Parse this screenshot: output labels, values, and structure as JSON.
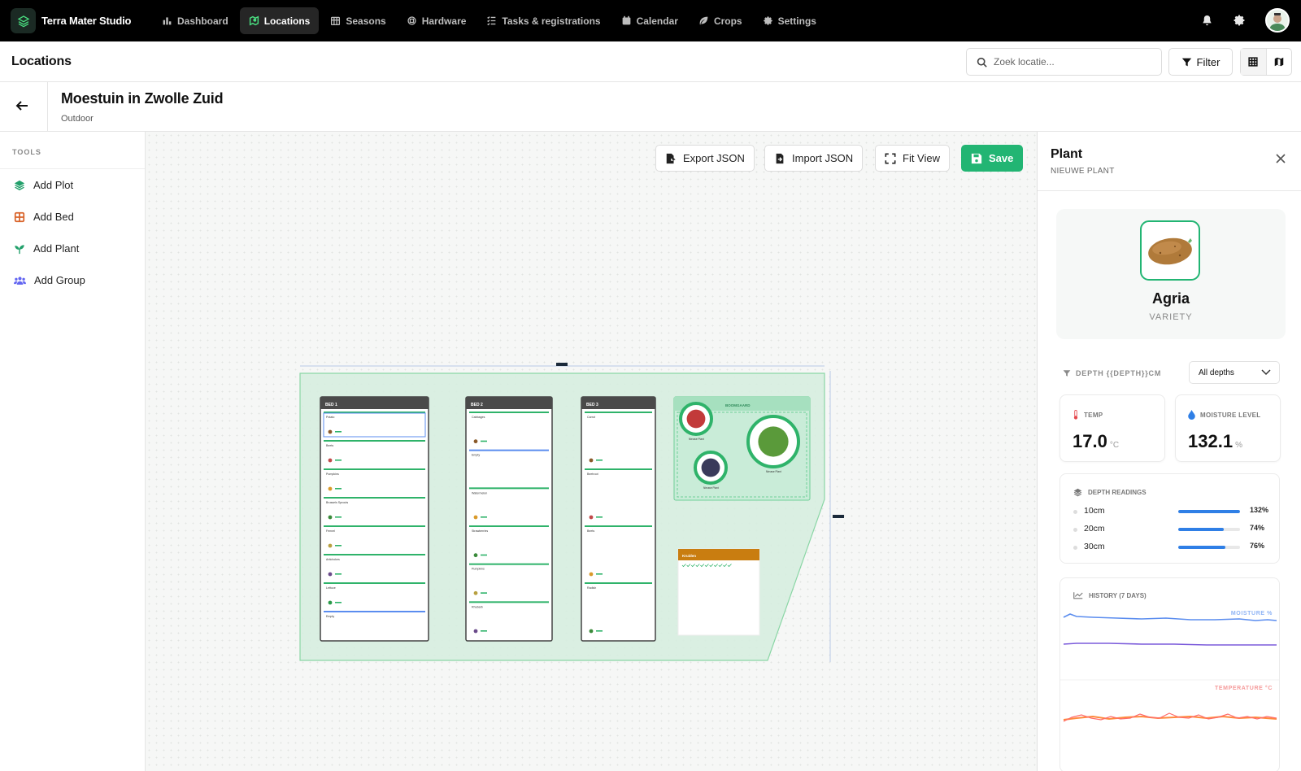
{
  "brand": {
    "name": "Terra Mater Studio"
  },
  "nav": [
    {
      "label": "Dashboard",
      "icon": "bar-chart-icon",
      "active": false
    },
    {
      "label": "Locations",
      "icon": "map-marker-icon",
      "active": true
    },
    {
      "label": "Seasons",
      "icon": "calendar-grid-icon",
      "active": false
    },
    {
      "label": "Hardware",
      "icon": "chip-icon",
      "active": false
    },
    {
      "label": "Tasks & registrations",
      "icon": "checklist-icon",
      "active": false
    },
    {
      "label": "Calendar",
      "icon": "calendar-icon",
      "active": false
    },
    {
      "label": "Crops",
      "icon": "leaf-icon",
      "active": false
    },
    {
      "label": "Settings",
      "icon": "gear-icon",
      "active": false
    }
  ],
  "header": {
    "title": "Locations",
    "search_placeholder": "Zoek locatie...",
    "filter_label": "Filter"
  },
  "location": {
    "title": "Moestuin in Zwolle Zuid",
    "subtitle": "Outdoor"
  },
  "tools": {
    "label": "TOOLS",
    "items": [
      {
        "label": "Add Plot",
        "icon": "layers-icon",
        "color": "#22a06b"
      },
      {
        "label": "Add Bed",
        "icon": "grid-icon",
        "color": "#d9642b"
      },
      {
        "label": "Add Plant",
        "icon": "sprout-icon",
        "color": "#22a06b"
      },
      {
        "label": "Add Group",
        "icon": "group-icon",
        "color": "#6366f1"
      }
    ]
  },
  "canvas_actions": {
    "export": "Export JSON",
    "import": "Import JSON",
    "fit": "Fit View",
    "save": "Save"
  },
  "canvas": {
    "beds": [
      {
        "title": "BED 1",
        "plants": [
          "Potato",
          "Beets",
          "Pumpkins",
          "Brussels Sprouts",
          "Fennel",
          "Artichokes",
          "Lettuce",
          "Empty"
        ]
      },
      {
        "title": "BED 2",
        "plants": [
          "Cabbages",
          "Empty",
          "Watermelon",
          "Strawberries",
          "Pumpkins",
          "Rhubarb"
        ]
      },
      {
        "title": "BED 3",
        "plants": [
          "Carrot",
          "Beetroot",
          "Beets",
          "Radish"
        ]
      }
    ],
    "group": {
      "title": "BOOMGAARD",
      "label_plant": "Nieuwe Plant"
    },
    "note": {
      "title": "Kruiden"
    }
  },
  "panel": {
    "title": "Plant",
    "subtitle": "NIEUWE PLANT",
    "variety": "Agria",
    "variety_label": "VARIETY",
    "depth_label": "DEPTH {{DEPTH}}CM",
    "depth_select": "All depths",
    "temp": {
      "label": "TEMP",
      "value": "17.0",
      "unit": "°C"
    },
    "moisture": {
      "label": "MOISTURE LEVEL",
      "value": "132.1",
      "unit": "%"
    },
    "readings_label": "DEPTH READINGS",
    "readings": [
      {
        "depth": "10cm",
        "pct": "132%",
        "fill": 1.0
      },
      {
        "depth": "20cm",
        "pct": "74%",
        "fill": 0.74
      },
      {
        "depth": "30cm",
        "pct": "76%",
        "fill": 0.76
      }
    ],
    "history_label": "HISTORY (7 DAYS)",
    "moisture_chart_label": "MOISTURE %",
    "temp_chart_label": "TEMPERATURE °C",
    "colors": {
      "moisture_a": "#5b8def",
      "moisture_b": "#7c5cdb",
      "temp_a": "#ff8a3d",
      "temp_b": "#ff6b6b"
    }
  }
}
